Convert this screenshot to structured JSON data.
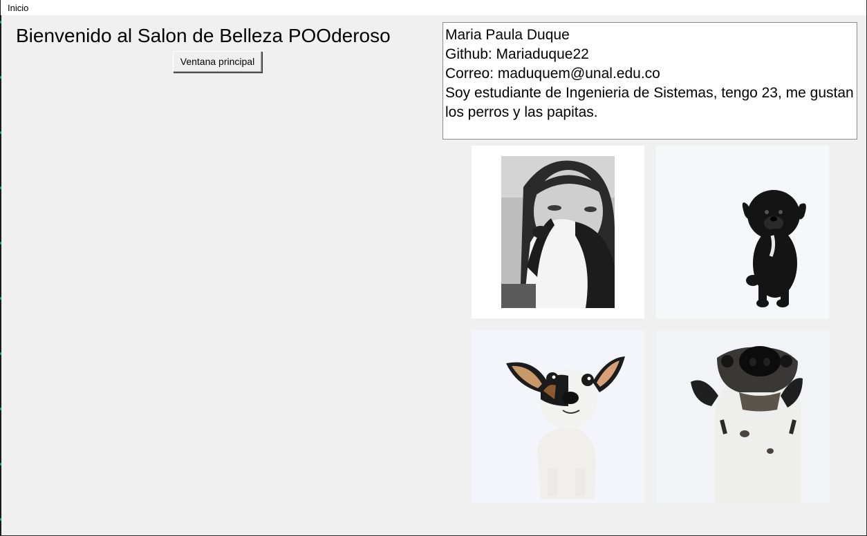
{
  "menubar": {
    "items": [
      {
        "label": "Inicio"
      }
    ]
  },
  "main": {
    "title": "Bienvenido al Salon de Belleza POOderoso",
    "button_label": "Ventana principal"
  },
  "bio": {
    "lines": [
      "Maria Paula Duque",
      "Github: Mariaduque22",
      "Correo: maduquem@unal.edu.co",
      "Soy estudiante de Ingenieria de Sistemas, tengo 23, me gustan los perros y las papitas."
    ]
  },
  "photos": [
    {
      "subject": "woman-with-dog-bw"
    },
    {
      "subject": "black-puppy"
    },
    {
      "subject": "chihuahua-tricolor"
    },
    {
      "subject": "dog-nose-closeup"
    }
  ]
}
